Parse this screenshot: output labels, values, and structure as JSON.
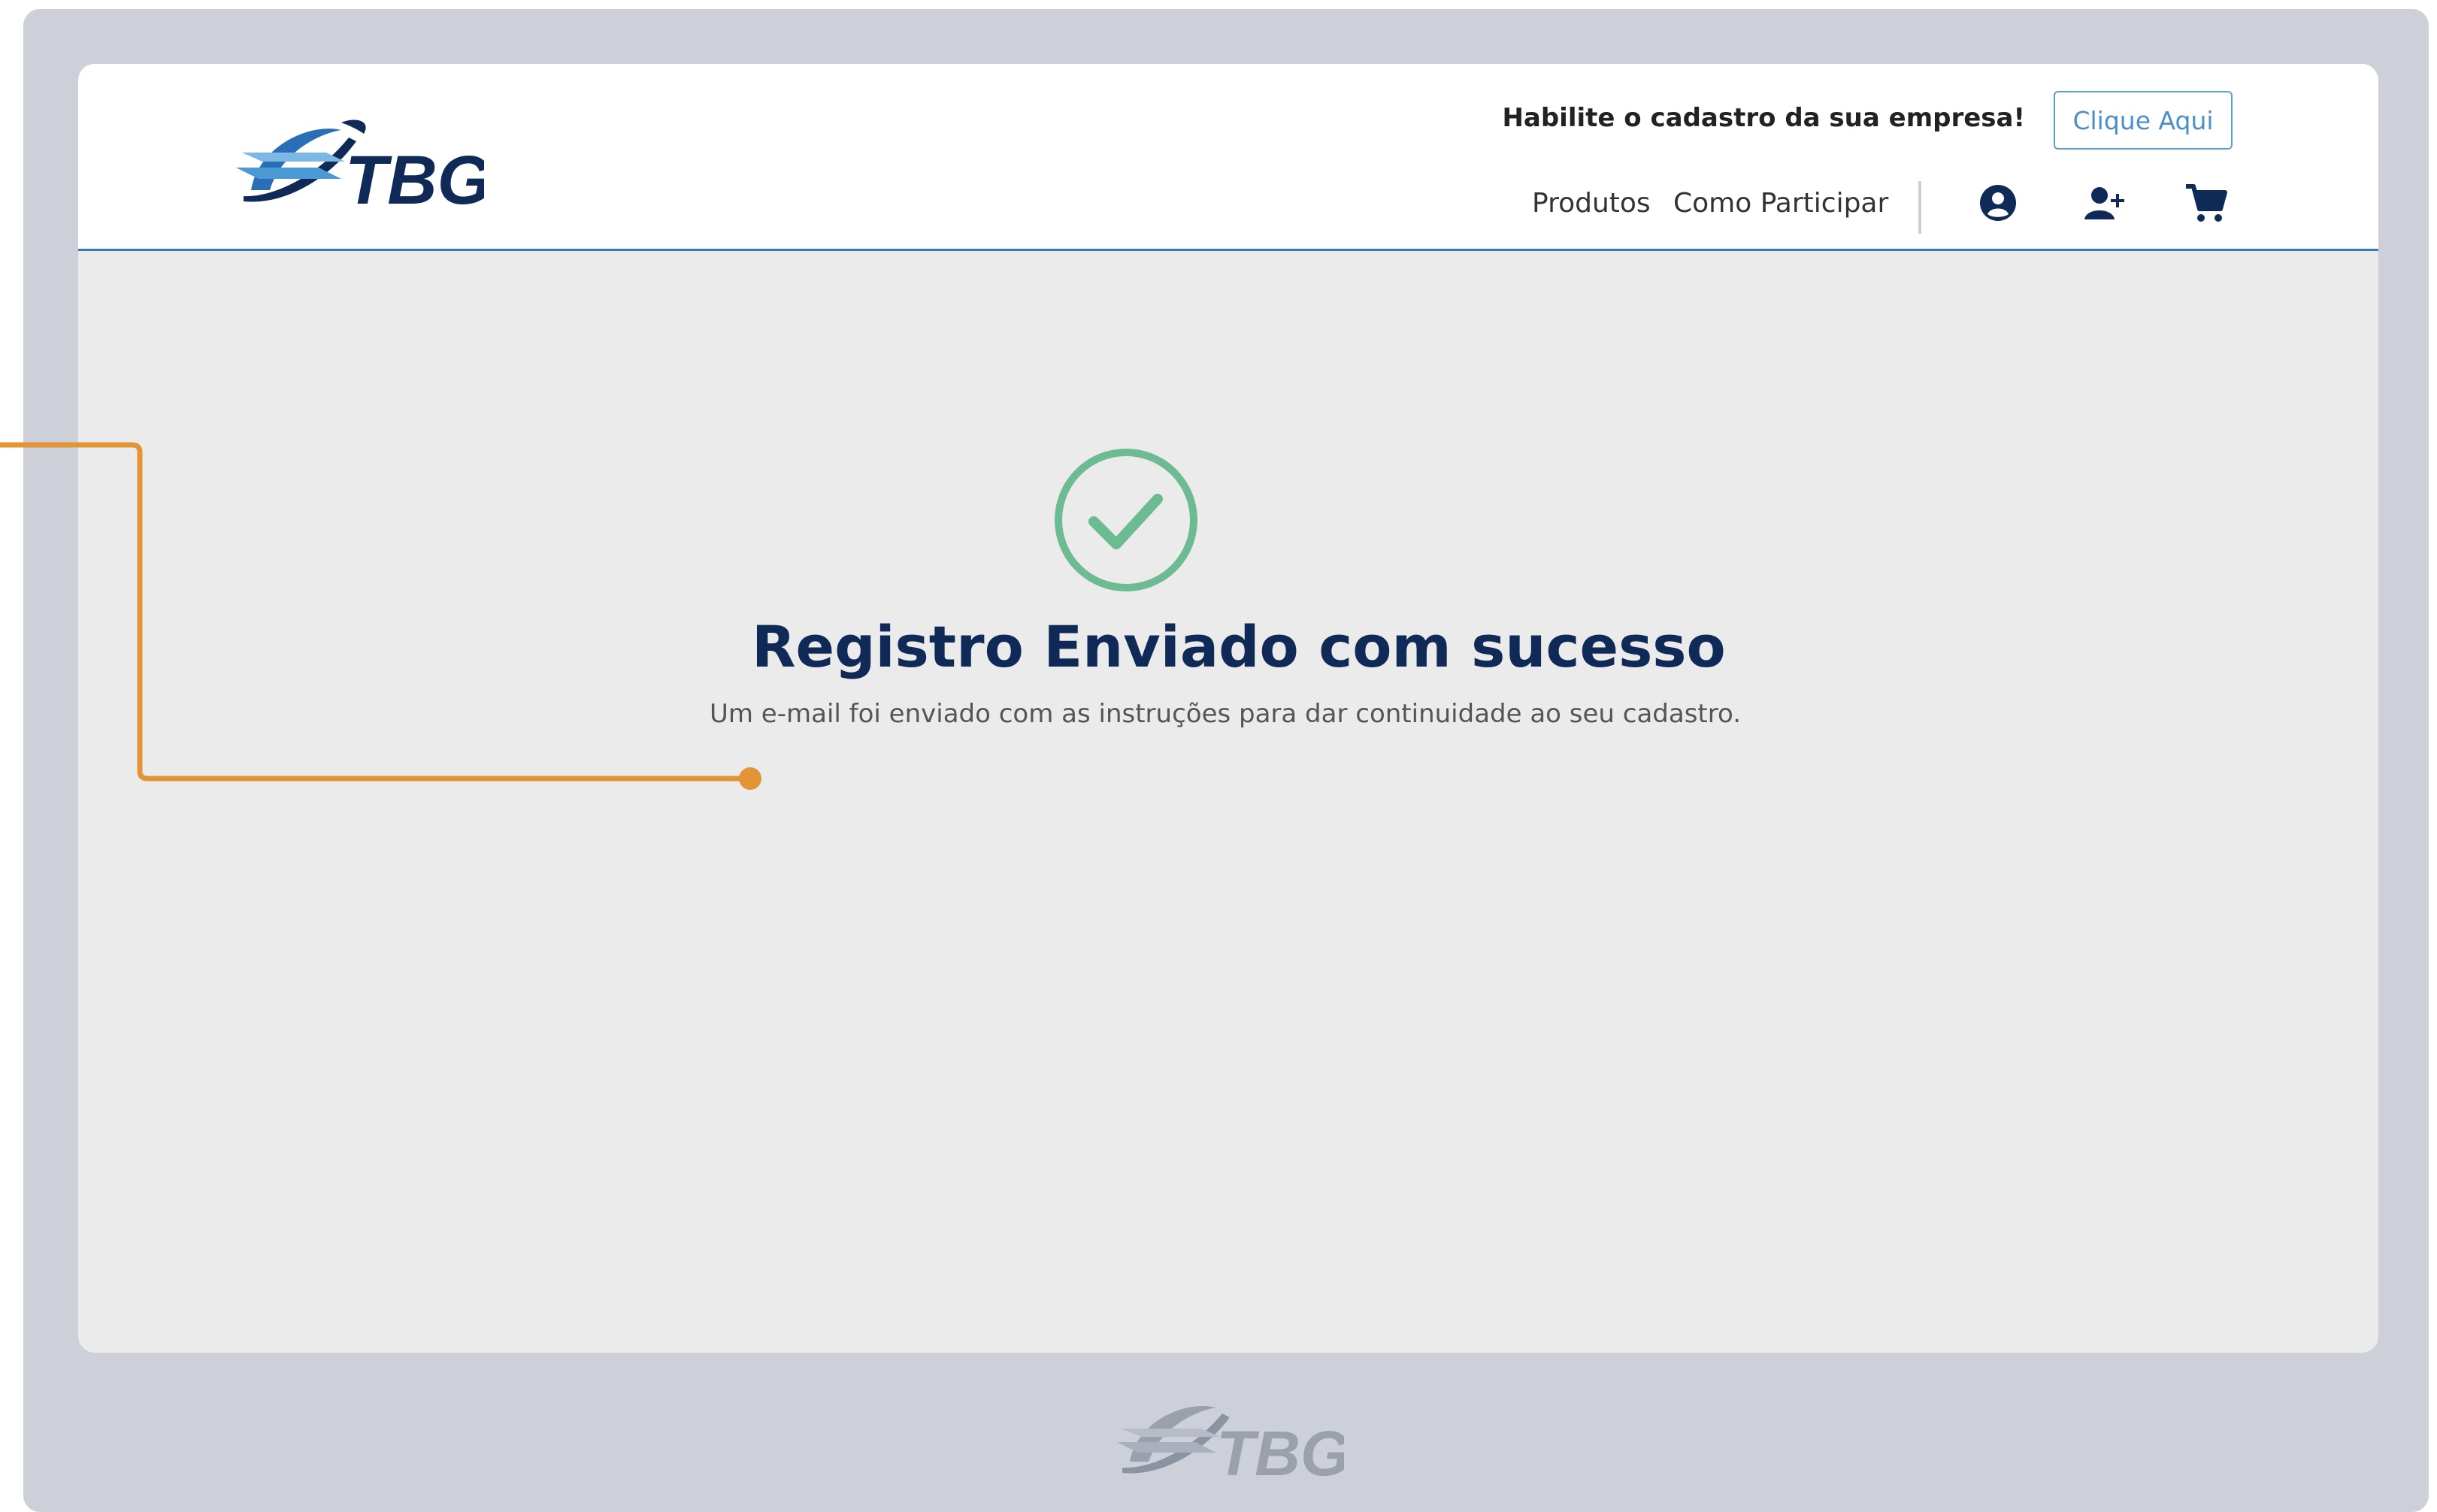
{
  "header": {
    "logo_text": "TBG",
    "promo_text": "Habilite o cadastro da sua empresa!",
    "promo_button": "Clique Aqui",
    "nav": [
      "Produtos",
      "Como Participar"
    ],
    "icons": [
      "user-circle-icon",
      "add-user-icon",
      "cart-icon"
    ]
  },
  "main": {
    "title": "Registro Enviado com sucesso",
    "subtitle": "Um e-mail foi enviado com as instruções para dar continuidade ao seu cadastro.",
    "status_icon": "check-circle-icon"
  },
  "footer": {
    "logo_text": "TBG"
  },
  "colors": {
    "brand_dark": "#0f2a57",
    "brand_blue": "#2e7db8",
    "success_green": "#6dbb93",
    "annotation_orange": "#e39436",
    "frame_gray": "#cdd0d8"
  }
}
